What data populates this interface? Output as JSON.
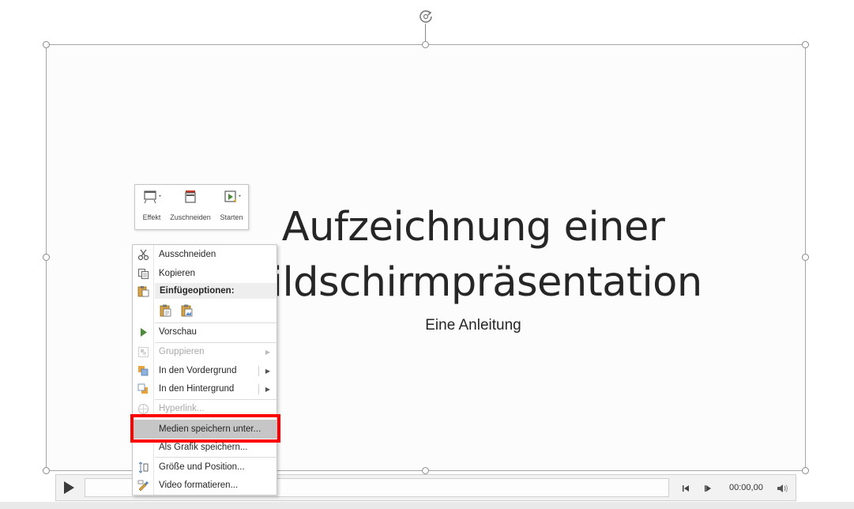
{
  "slide": {
    "title": "Aufzeichnung einer Bildschirmpräsentation",
    "subtitle": "Eine Anleitung"
  },
  "mini_toolbar": {
    "buttons": [
      {
        "label": "Effekt",
        "icon": "effect-icon"
      },
      {
        "label": "Zuschneiden",
        "icon": "crop-icon"
      },
      {
        "label": "Starten",
        "icon": "start-icon"
      }
    ]
  },
  "context_menu": {
    "items": [
      {
        "label": "Ausschneiden",
        "icon": "scissors-icon",
        "enabled": true
      },
      {
        "label": "Kopieren",
        "icon": "copy-icon",
        "enabled": true
      },
      {
        "label": "Einfügeoptionen:",
        "icon": "paste-icon",
        "is_header": true
      },
      {
        "label": "Vorschau",
        "icon": "preview-icon",
        "enabled": true
      },
      {
        "label": "Gruppieren",
        "icon": "group-icon",
        "enabled": false,
        "submenu": true
      },
      {
        "label": "In den Vordergrund",
        "icon": "bring-forward-icon",
        "enabled": true,
        "submenu": true
      },
      {
        "label": "In den Hintergrund",
        "icon": "send-backward-icon",
        "enabled": true,
        "submenu": true
      },
      {
        "label": "Hyperlink...",
        "icon": "hyperlink-icon",
        "enabled": false
      },
      {
        "label": "Medien speichern unter...",
        "icon": "",
        "enabled": true,
        "hovered": true
      },
      {
        "label": "Als Grafik speichern...",
        "icon": "",
        "enabled": true
      },
      {
        "label": "Größe und Position...",
        "icon": "size-position-icon",
        "enabled": true
      },
      {
        "label": "Video formatieren...",
        "icon": "format-video-icon",
        "enabled": true
      }
    ]
  },
  "player": {
    "time": "00:00,00"
  },
  "colors": {
    "highlight": "#ff0000",
    "play_green": "#4f8a3c"
  }
}
